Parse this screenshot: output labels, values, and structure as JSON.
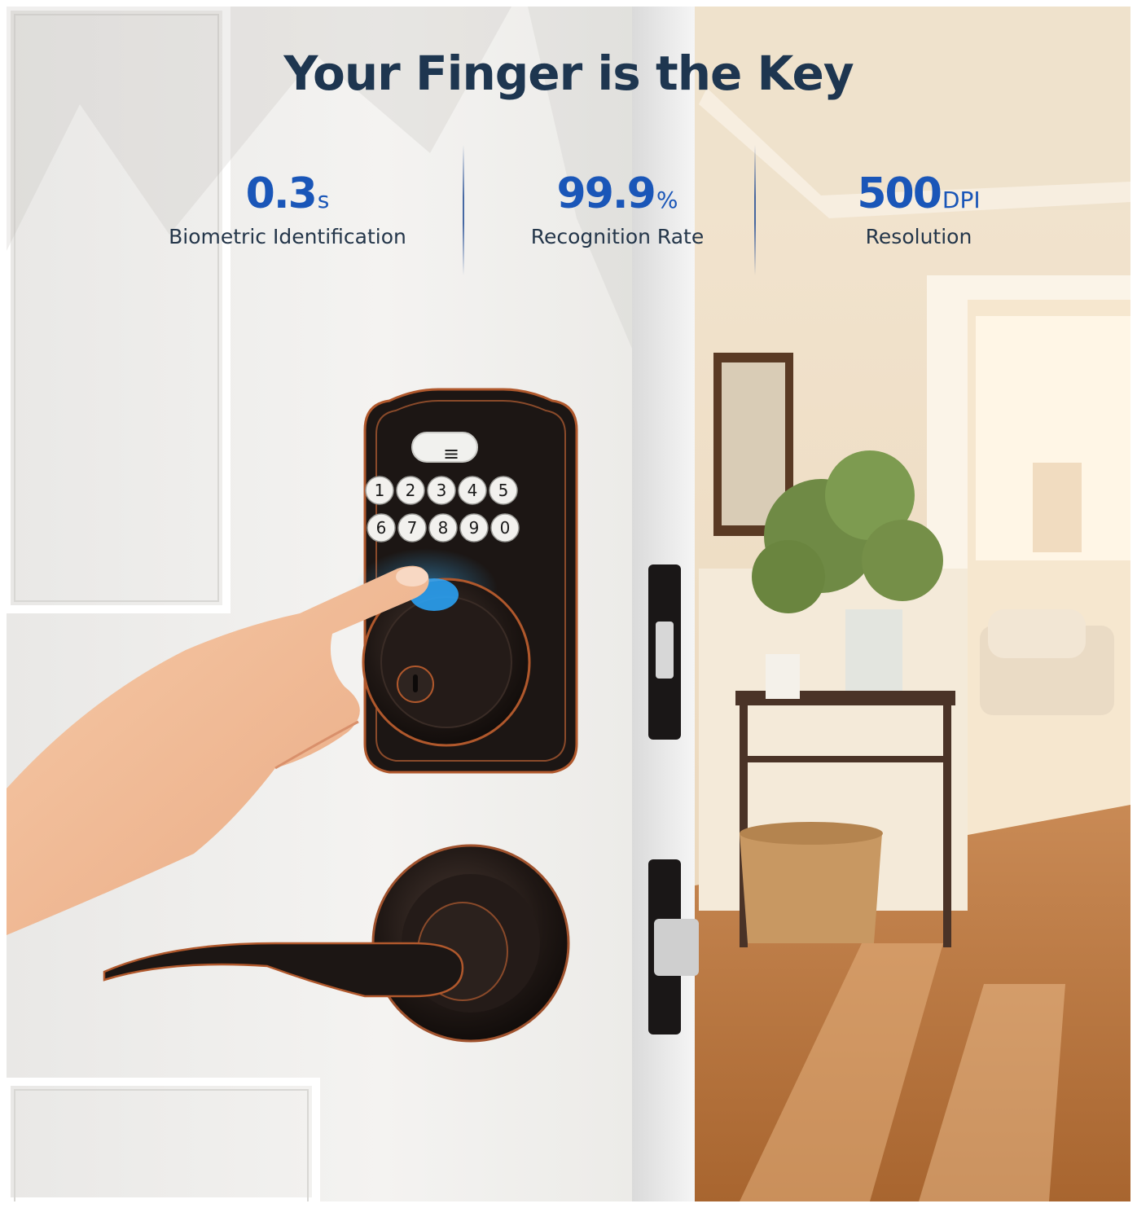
{
  "headline": "Your Finger is the Key",
  "stats": [
    {
      "value": "0.3",
      "unit": "s",
      "label": "Biometric Identification"
    },
    {
      "value": "99.9",
      "unit": "%",
      "label": "Recognition Rate"
    },
    {
      "value": "500",
      "unit": "DPI",
      "label": "Resolution"
    }
  ],
  "keypad": {
    "menu_symbol": "≡",
    "keys": [
      "1",
      "2",
      "3",
      "4",
      "5",
      "6",
      "7",
      "8",
      "9",
      "0"
    ]
  },
  "colors": {
    "headline": "#1e3650",
    "accent": "#1a56b8",
    "label": "#24364a",
    "lock_finish": "#1c1614",
    "copper_trim": "#b0582c"
  }
}
